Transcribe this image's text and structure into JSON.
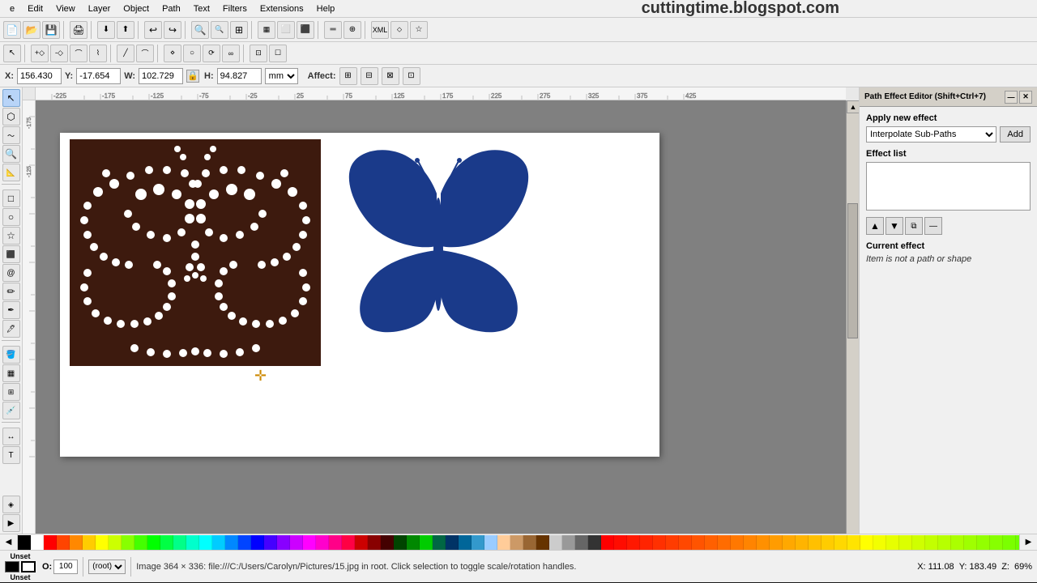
{
  "app": {
    "title": "Path Effect Editor (Shift+Ctrl+7)",
    "website": "cuttingtime.blogspot.com"
  },
  "menubar": {
    "items": [
      "e",
      "Edit",
      "View",
      "Layer",
      "Object",
      "Path",
      "Text",
      "Filters",
      "Extensions",
      "Help"
    ]
  },
  "toolbar1": {
    "buttons": [
      "📄",
      "📂",
      "💾",
      "🖨",
      "✂",
      "📋",
      "📋",
      "↩",
      "↪",
      "🔍",
      "🔍",
      "🔍",
      "⬜",
      "⬛",
      "▦",
      "→",
      "⊞",
      "📐",
      "📏",
      "🔧",
      "🔗",
      "🔗",
      "🔗",
      "🔗"
    ]
  },
  "toolbar2": {
    "buttons": [
      "↖",
      "⬡",
      "⬡",
      "⬡",
      "⬡",
      "⬡",
      "⬡",
      "⬡",
      "⬡",
      "⬡",
      "⬡",
      "⬡",
      "⬡",
      "⬡",
      "⬡",
      "⬡",
      "⬡"
    ]
  },
  "coordbar": {
    "x_label": "X:",
    "x_value": "156.430",
    "y_label": "Y:",
    "y_value": "-17.654",
    "w_label": "W:",
    "w_value": "102.729",
    "h_label": "H:",
    "h_value": "94.827",
    "unit": "mm",
    "affect_label": "Affect:"
  },
  "pee": {
    "title": "Path Effect Editor (Shift+Ctrl+7)",
    "apply_label": "Apply new effect",
    "effect_options": [
      "Interpolate Sub-Paths"
    ],
    "add_button": "Add",
    "effect_list_label": "Effect list",
    "current_effect_label": "Current effect",
    "current_effect_text": "Item is not a path or shape"
  },
  "statusbar": {
    "fill_label": "Unset",
    "stroke_label": "Unset",
    "opacity_label": "O:",
    "opacity_value": "100",
    "layer_label": "(root)",
    "status_text": "Image 364 × 336: file:///C:/Users/Carolyn/Pictures/15.jpg in root. Click selection to toggle scale/rotation handles.",
    "x_coord": "X: 111.08",
    "y_coord": "Y: 183.49",
    "zoom_label": "Z:",
    "zoom_value": "69%"
  },
  "palette": {
    "colors": [
      "#000000",
      "#ffffff",
      "#ff0000",
      "#ff4400",
      "#ff8800",
      "#ffcc00",
      "#ffff00",
      "#ccff00",
      "#88ff00",
      "#44ff00",
      "#00ff00",
      "#00ff44",
      "#00ff88",
      "#00ffcc",
      "#00ffff",
      "#00ccff",
      "#0088ff",
      "#0044ff",
      "#0000ff",
      "#4400ff",
      "#8800ff",
      "#cc00ff",
      "#ff00ff",
      "#ff00cc",
      "#ff0088",
      "#ff0044",
      "#cc0000",
      "#880000",
      "#440000",
      "#004400",
      "#008800",
      "#00cc00",
      "#006644",
      "#003366",
      "#006699",
      "#3399cc",
      "#99ccff",
      "#ffcc99",
      "#cc9966",
      "#996633",
      "#663300",
      "#cccccc",
      "#999999",
      "#666666",
      "#333333"
    ]
  }
}
